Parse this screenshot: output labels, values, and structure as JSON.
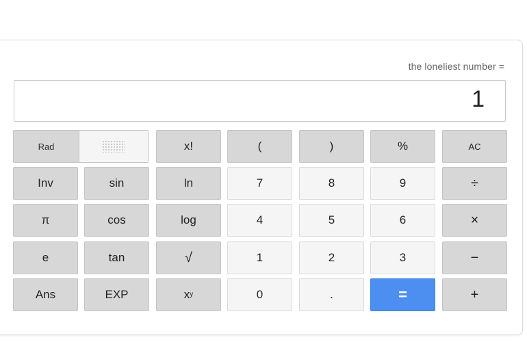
{
  "calculator": {
    "expression": "the loneliest number =",
    "result": "1",
    "angle_toggle": {
      "rad_label": "Rad"
    },
    "keys": {
      "fact": "x!",
      "open_paren": "(",
      "close_paren": ")",
      "percent": "%",
      "clear": "AC",
      "inv": "Inv",
      "sin": "sin",
      "ln": "ln",
      "seven": "7",
      "eight": "8",
      "nine": "9",
      "divide": "÷",
      "pi": "π",
      "cos": "cos",
      "log": "log",
      "four": "4",
      "five": "5",
      "six": "6",
      "multiply": "×",
      "e": "e",
      "tan": "tan",
      "sqrt": "√",
      "one": "1",
      "two": "2",
      "three": "3",
      "minus": "−",
      "ans": "Ans",
      "exp": "EXP",
      "power_base": "x",
      "power_exp": "y",
      "zero": "0",
      "dot": ".",
      "equals": "=",
      "plus": "+"
    },
    "colors": {
      "equals_key": "#4d8ff0",
      "function_key": "#d7d7d7",
      "number_key": "#f5f5f5"
    }
  }
}
